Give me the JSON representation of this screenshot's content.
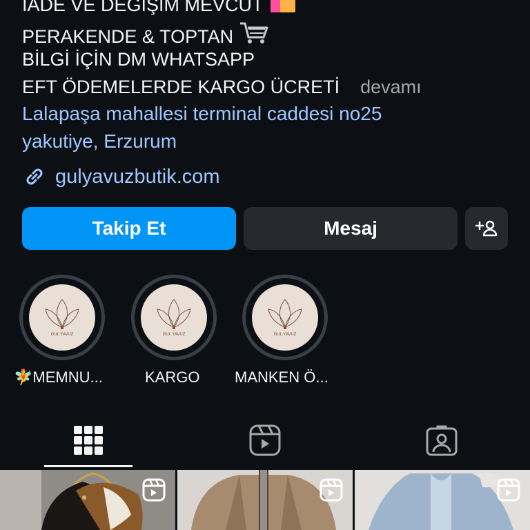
{
  "bio": {
    "line1": "İADE VE DEĞİŞİM MEVCUT",
    "line2": "PERAKENDE & TOPTAN",
    "line3": "BİLGİ İÇİN DM WHATSAPP",
    "line4": "EFT ÖDEMELERDE KARGO ÜCRETİ",
    "more_label": "devamı",
    "line1_icon": "shopping-bags-icon",
    "line2_icon": "shopping-cart-icon"
  },
  "location": {
    "line1": "Lalapaşa mahallesi terminal caddesi no25",
    "line2": "yakutiye, Erzurum"
  },
  "website": {
    "icon": "link-icon",
    "url": "gulyavuzbutik.com"
  },
  "actions": {
    "follow_label": "Takip Et",
    "message_label": "Mesaj",
    "add_user_icon": "add-person-icon"
  },
  "highlights": [
    {
      "label": "🧚MEMNU...",
      "logo_text": "GUL YAVUZ"
    },
    {
      "label": "KARGO",
      "logo_text": "GUL YAVUZ"
    },
    {
      "label": "MANKEN Ö...",
      "logo_text": "GUL YAVUZ"
    }
  ],
  "tabs": [
    {
      "name": "grid",
      "icon": "grid-icon",
      "active": true
    },
    {
      "name": "reels",
      "icon": "reels-icon",
      "active": false
    },
    {
      "name": "tagged",
      "icon": "tagged-person-icon",
      "active": false
    }
  ],
  "posts": [
    {
      "type": "reel",
      "icon": "reel-icon"
    },
    {
      "type": "reel",
      "icon": "reel-icon"
    },
    {
      "type": "reel",
      "icon": "reel-icon"
    }
  ],
  "colors": {
    "background": "#0c1014",
    "follow_button": "#0095f6",
    "secondary_button": "#262a2f",
    "link": "#9fc8ff",
    "muted_text": "#a8a8a8"
  }
}
